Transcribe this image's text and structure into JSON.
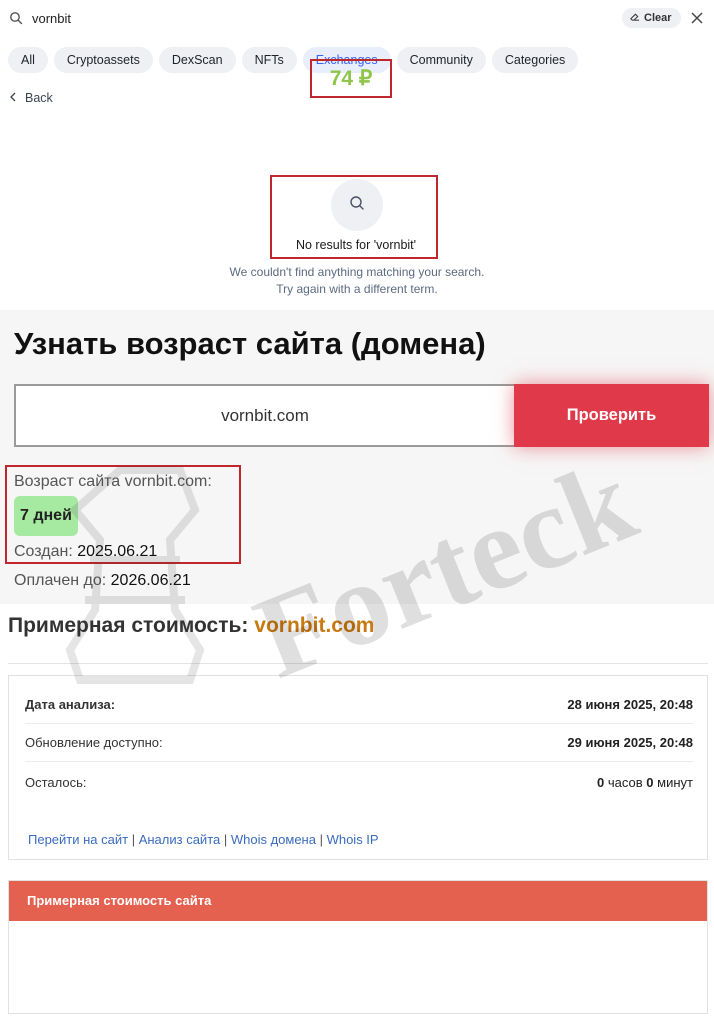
{
  "search": {
    "query": "vornbit",
    "clear_label": "Clear"
  },
  "filters": [
    {
      "label": "All",
      "active": false
    },
    {
      "label": "Cryptoassets",
      "active": false
    },
    {
      "label": "DexScan",
      "active": false
    },
    {
      "label": "NFTs",
      "active": false
    },
    {
      "label": "Exchanges",
      "active": true
    },
    {
      "label": "Community",
      "active": false
    },
    {
      "label": "Categories",
      "active": false
    }
  ],
  "back_label": "Back",
  "no_results": {
    "title": "No results for 'vornbit'",
    "line1": "We couldn't find anything matching your search.",
    "line2": "Try again with a different term."
  },
  "age_checker": {
    "title": "Узнать возраст сайта (домена)",
    "domain_value": "vornbit.com",
    "check_button": "Проверить",
    "age_label": "Возраст сайта vornbit.com:",
    "age_value": "7 дней",
    "created_label": "Создан:",
    "created_value": "2025.06.21",
    "paid_label": "Оплачен до:",
    "paid_value": "2026.06.21"
  },
  "cost": {
    "heading": "Примерная стоимость:",
    "domain": "vornbit.com",
    "rows": [
      {
        "label": "Дата анализа:",
        "value": "28 июня 2025, 20:48"
      },
      {
        "label": "Обновление доступно:",
        "value": "29 июня 2025, 20:48"
      }
    ],
    "remaining_label": "Осталось:",
    "remaining_hours": "0",
    "hours_unit": "часов",
    "remaining_minutes": "0",
    "minutes_unit": "минут",
    "links": [
      "Перейти на сайт",
      "Анализ сайта",
      "Whois домена",
      "Whois IP"
    ],
    "price_header": "Примерная стоимость сайта",
    "price_value": "74 ₽"
  },
  "watermark": {
    "text": "Forteck"
  },
  "colors": {
    "accent_blue": "#3861fb",
    "check_red": "#e03a4a",
    "highlight_red": "#c0272d",
    "price_header": "#e4604f",
    "price_green": "#8fc64a",
    "domain_orange": "#c87a12",
    "badge_green": "#a6e9a1"
  }
}
